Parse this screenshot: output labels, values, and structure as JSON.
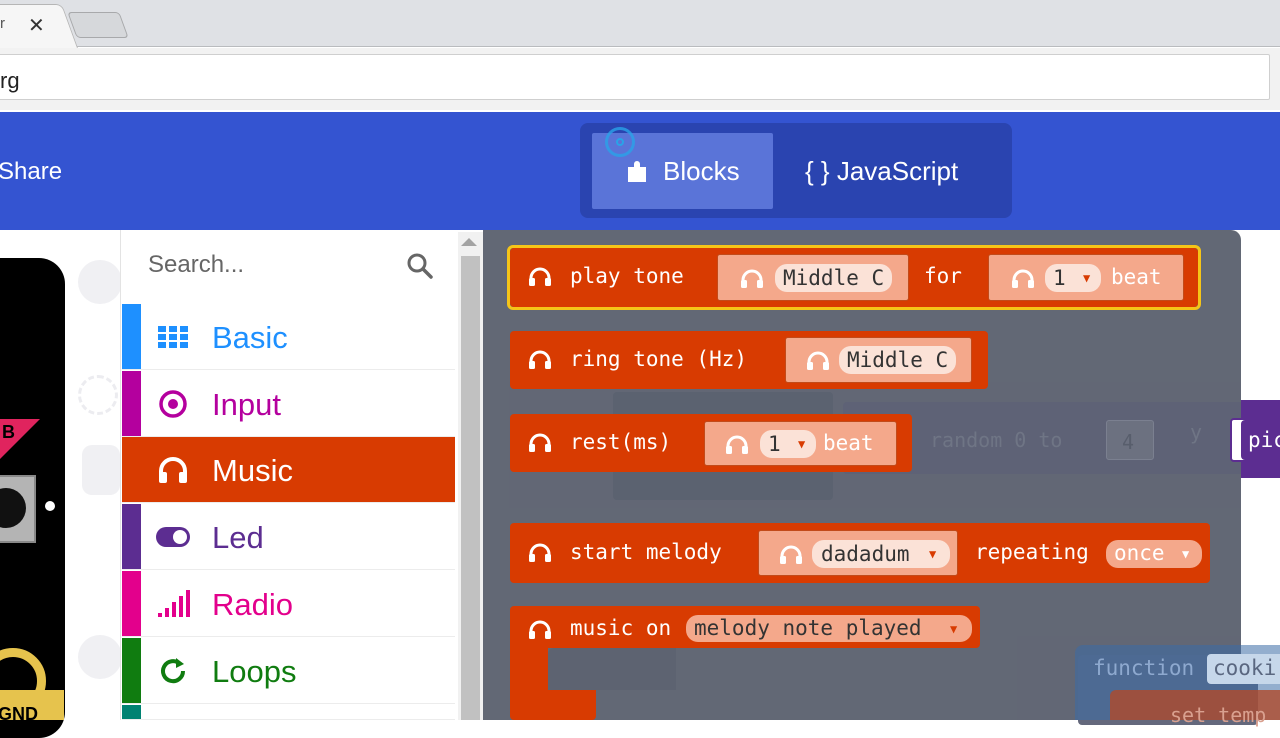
{
  "browser": {
    "tab_title": "r",
    "tab_close": "✕",
    "url": "rg"
  },
  "header": {
    "share_label": "Share",
    "blocks_label": "Blocks",
    "javascript_label": "{ } JavaScript",
    "brand_color": "#3454d1"
  },
  "simulator": {
    "button_b_label": "B",
    "gnd_label": "GND"
  },
  "toolbox": {
    "search_placeholder": "Search...",
    "categories": [
      {
        "label": "Basic",
        "color": "#1e90ff",
        "icon": "grid-icon"
      },
      {
        "label": "Input",
        "color": "#b4009e",
        "icon": "radio-button-icon"
      },
      {
        "label": "Music",
        "color": "#d83b01",
        "icon": "headphones-icon",
        "selected": true
      },
      {
        "label": "Led",
        "color": "#5c2d91",
        "icon": "toggle-icon"
      },
      {
        "label": "Radio",
        "color": "#e3008c",
        "icon": "signal-bars-icon"
      },
      {
        "label": "Loops",
        "color": "#107c10",
        "icon": "refresh-icon"
      }
    ]
  },
  "flyout": {
    "play_tone": {
      "text": "play tone",
      "note": "Middle C",
      "for": "for",
      "beats": "1",
      "beat_word": "beat"
    },
    "ring_tone": {
      "text": "ring tone (Hz)",
      "note": "Middle C"
    },
    "rest": {
      "text": "rest(ms)",
      "beats": "1",
      "beat_word": "beat"
    },
    "start_melody": {
      "text": "start melody",
      "melody": "dadadum",
      "repeating": "repeating",
      "repeat_option": "once"
    },
    "music_on": {
      "text": "music on",
      "event": "melody note played"
    }
  },
  "workspace": {
    "random_text": "random 0 to",
    "random_max": "4",
    "y_label": "y",
    "pick_label": "pic",
    "function_label": "function",
    "function_name": "cooki",
    "set_label": "set temp"
  }
}
